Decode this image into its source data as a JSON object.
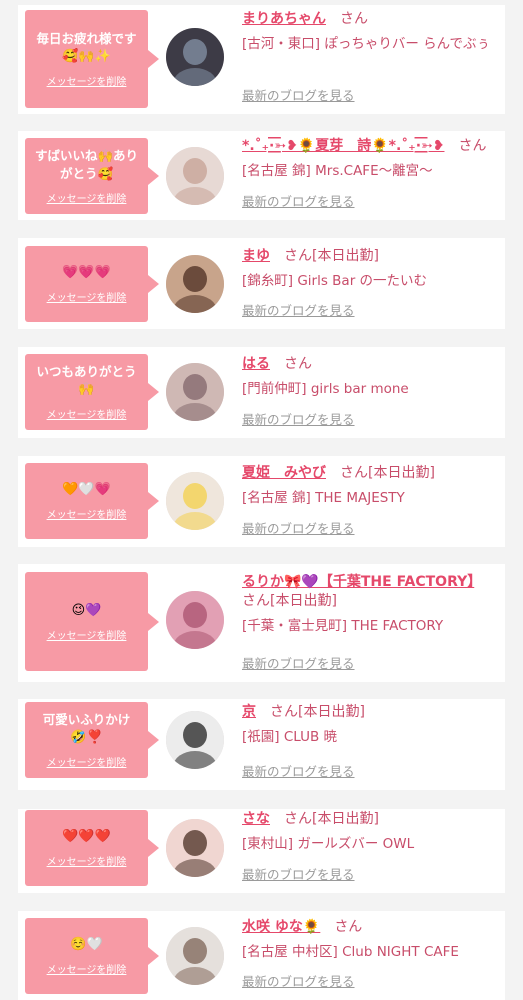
{
  "delete_label": "メッセージを削除",
  "honorific": "さん",
  "on_duty_label": "[本日出勤]",
  "blog_link_label": "最新のブログを見る",
  "colors": {
    "background": "#f3f3f3",
    "bubble": "#f79aa5",
    "name": "#e5486a",
    "text": "#c84d6a",
    "link_gray": "#9a9a9a"
  },
  "messages": [
    {
      "message_text": "毎日お疲れ様です",
      "message_emoji": "🥰🙌✨",
      "avatar_icon": "avatar-photo-icon",
      "name": "まりあちゃん",
      "on_duty": false,
      "shop": "[古河・東口] ぽっちゃりバー らんでぶぅ"
    },
    {
      "message_text": "すばいいね🙌ありがとう🥰",
      "message_emoji": "",
      "avatar_icon": "avatar-photo-icon",
      "name": "*.˚₊·͟͟͟͟͟͟͞͞͞͞͞͞➳❥🌻夏芽　詩🌻*.˚₊·͟͟͟͟͟͟͞͞͞͞͞͞➳❥",
      "on_duty": false,
      "shop": "[名古屋 錦] Mrs.CAFE〜離宮〜"
    },
    {
      "message_text": "",
      "message_emoji": "💗💗💗",
      "avatar_icon": "avatar-photo-icon",
      "name": "まゆ",
      "on_duty": true,
      "shop": "[錦糸町] Girls Bar の一たいむ"
    },
    {
      "message_text": "いつもありがとう",
      "message_emoji": "🙌",
      "avatar_icon": "avatar-photo-icon",
      "name": "はる",
      "on_duty": false,
      "shop": "[門前仲町] girls bar mone"
    },
    {
      "message_text": "",
      "message_emoji": "🧡🤍💗",
      "avatar_icon": "avatar-photo-icon",
      "name": "夏姫　みやび",
      "on_duty": true,
      "shop": "[名古屋 錦] THE MAJESTY"
    },
    {
      "message_text": "",
      "message_emoji": "😉💜",
      "avatar_icon": "avatar-photo-icon",
      "name": "るりか🎀💜【千葉THE FACTORY】",
      "on_duty": true,
      "shop": "[千葉・富士見町] THE FACTORY"
    },
    {
      "message_text": "可愛いふりかけ",
      "message_emoji": "🤣❣️",
      "avatar_icon": "avatar-photo-icon",
      "name": "京",
      "on_duty": true,
      "shop": "[祇園] CLUB 暁"
    },
    {
      "message_text": "",
      "message_emoji": "❤️❤️❤️",
      "avatar_icon": "avatar-photo-icon",
      "name": "さな",
      "on_duty": true,
      "shop": "[東村山] ガールズバー OWL"
    },
    {
      "message_text": "",
      "message_emoji": "☺️🤍",
      "avatar_icon": "avatar-photo-icon",
      "name": "水咲 ゆな🌻",
      "on_duty": false,
      "shop": "[名古屋 中村区] Club NIGHT CAFE"
    }
  ]
}
